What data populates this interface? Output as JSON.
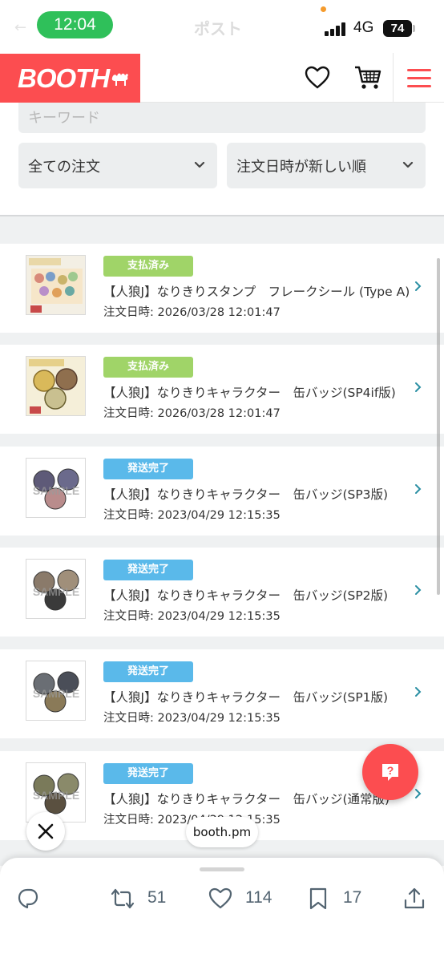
{
  "status_bar": {
    "time": "12:04",
    "ghost_title": "ポスト",
    "network": "4G",
    "battery": "74"
  },
  "header": {
    "logo": "BOOTH"
  },
  "filters": {
    "keyword_placeholder": "キーワード",
    "order_filter": "全ての注文",
    "sort": "注文日時が新しい順"
  },
  "orders": [
    {
      "status": "支払済み",
      "status_color": "#a0d468",
      "title": "【人狼J】なりきりスタンプ　フレークシール (Type A)",
      "date": "注文日時: 2026/03/28 12:01:47"
    },
    {
      "status": "支払済み",
      "status_color": "#a0d468",
      "title": "【人狼J】なりきりキャラクター　缶バッジ(SP4if版)",
      "date": "注文日時: 2026/03/28 12:01:47"
    },
    {
      "status": "発送完了",
      "status_color": "#5ab9ea",
      "title": "【人狼J】なりきりキャラクター　缶バッジ(SP3版)",
      "date": "注文日時: 2023/04/29 12:15:35"
    },
    {
      "status": "発送完了",
      "status_color": "#5ab9ea",
      "title": "【人狼J】なりきりキャラクター　缶バッジ(SP2版)",
      "date": "注文日時: 2023/04/29 12:15:35"
    },
    {
      "status": "発送完了",
      "status_color": "#5ab9ea",
      "title": "【人狼J】なりきりキャラクター　缶バッジ(SP1版)",
      "date": "注文日時: 2023/04/29 12:15:35"
    },
    {
      "status": "発送完了",
      "status_color": "#5ab9ea",
      "title": "【人狼J】なりきりキャラクター　缶バッジ(通常版)",
      "date": "注文日時: 2023/04/29 12:15:35"
    }
  ],
  "overlay": {
    "domain": "booth.pm"
  },
  "actions": {
    "retweets": "51",
    "likes": "114",
    "bookmarks": "17"
  },
  "colors": {
    "brand": "#fc4d50",
    "paid": "#a0d468",
    "shipped": "#5ab9ea"
  }
}
